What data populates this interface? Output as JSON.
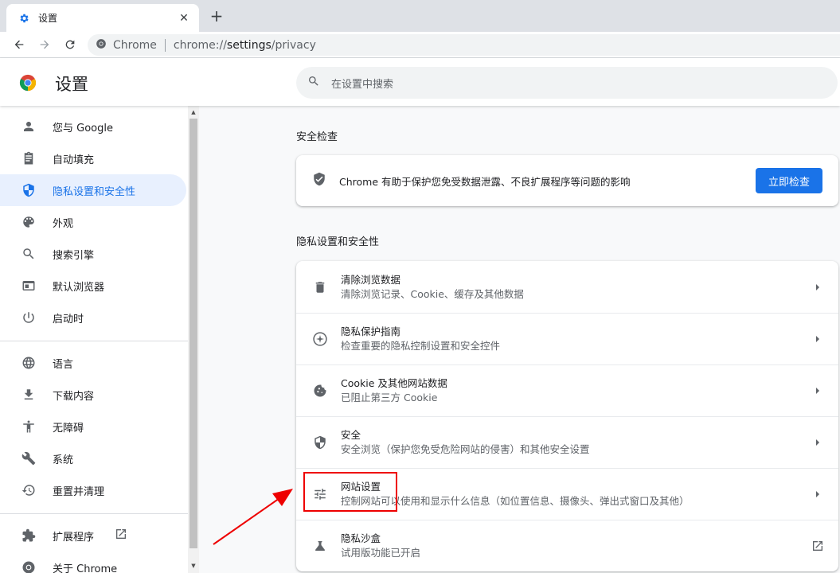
{
  "tab": {
    "title": "设置",
    "close": "✕",
    "newtab": "+"
  },
  "omnibox": {
    "label": "Chrome",
    "url_scheme": "chrome://",
    "url_host": "settings",
    "url_path": "/privacy"
  },
  "header": {
    "title": "设置",
    "search_placeholder": "在设置中搜索"
  },
  "sidebar": {
    "items": [
      {
        "label": "您与 Google",
        "icon": "person-icon"
      },
      {
        "label": "自动填充",
        "icon": "clipboard-icon"
      },
      {
        "label": "隐私设置和安全性",
        "icon": "shield-icon",
        "active": true
      },
      {
        "label": "外观",
        "icon": "palette-icon"
      },
      {
        "label": "搜索引擎",
        "icon": "search-icon"
      },
      {
        "label": "默认浏览器",
        "icon": "browser-icon"
      },
      {
        "label": "启动时",
        "icon": "power-icon"
      },
      {
        "label": "语言",
        "icon": "globe-icon"
      },
      {
        "label": "下载内容",
        "icon": "download-icon"
      },
      {
        "label": "无障碍",
        "icon": "accessibility-icon"
      },
      {
        "label": "系统",
        "icon": "wrench-icon"
      },
      {
        "label": "重置并清理",
        "icon": "restore-icon"
      },
      {
        "label": "扩展程序",
        "icon": "puzzle-icon"
      },
      {
        "label": "关于 Chrome",
        "icon": "chrome-icon"
      }
    ]
  },
  "safety_check": {
    "section_title": "安全检查",
    "text": "Chrome 有助于保护您免受数据泄露、不良扩展程序等问题的影响",
    "button": "立即检查"
  },
  "privacy": {
    "section_title": "隐私设置和安全性",
    "rows": [
      {
        "title": "清除浏览数据",
        "subtitle": "清除浏览记录、Cookie、缓存及其他数据",
        "icon": "trash-icon"
      },
      {
        "title": "隐私保护指南",
        "subtitle": "检查重要的隐私控制设置和安全控件",
        "icon": "compass-icon"
      },
      {
        "title": "Cookie 及其他网站数据",
        "subtitle": "已阻止第三方 Cookie",
        "icon": "cookie-icon"
      },
      {
        "title": "安全",
        "subtitle": "安全浏览（保护您免受危险网站的侵害）和其他安全设置",
        "icon": "shield-half-icon"
      },
      {
        "title": "网站设置",
        "subtitle": "控制网站可以使用和显示什么信息（如位置信息、摄像头、弹出式窗口及其他）",
        "icon": "tune-icon"
      },
      {
        "title": "隐私沙盒",
        "subtitle": "试用版功能已开启",
        "icon": "flask-icon"
      }
    ]
  },
  "colors": {
    "accent": "#1a73e8",
    "annotation": "#e00000"
  }
}
